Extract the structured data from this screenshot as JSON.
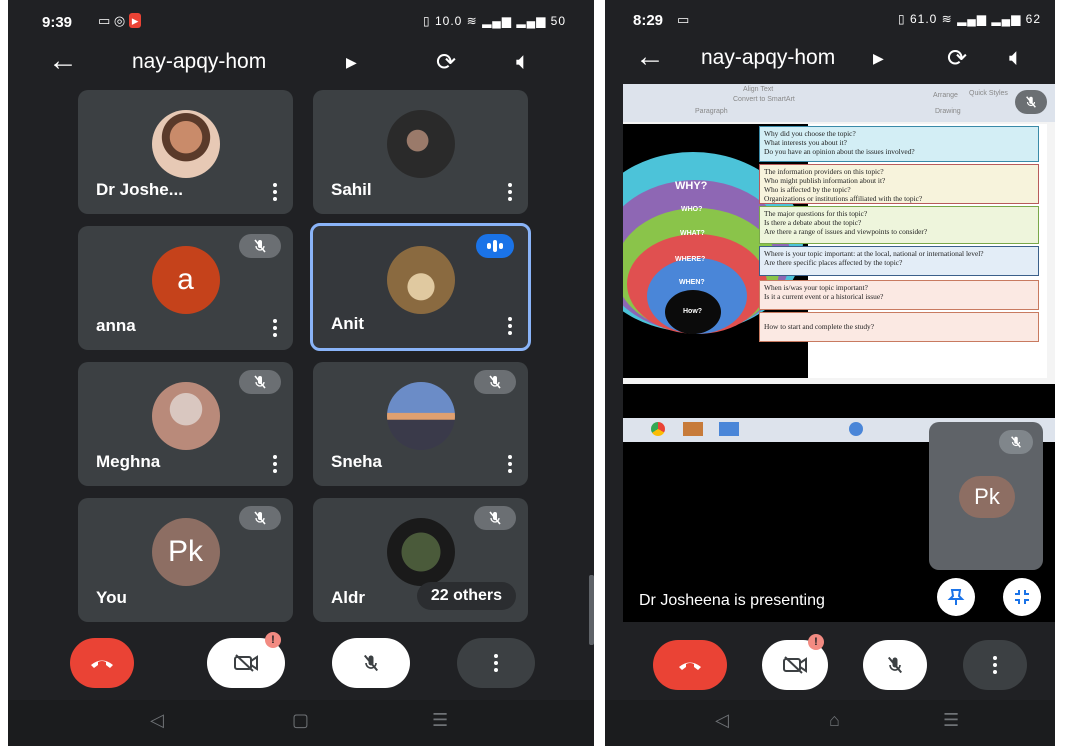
{
  "left": {
    "status": {
      "time": "9:39",
      "icons": "▯ 10.0 ≋ ▂▄▆ ▂▄▆ 50"
    },
    "meeting_code": "nay-apqy-hom",
    "tiles": [
      {
        "name": "Dr Joshe...",
        "avatar": "photo",
        "muted": false,
        "speaking": false
      },
      {
        "name": "Sahil",
        "avatar": "photo",
        "muted": false,
        "speaking": false
      },
      {
        "name": "anna",
        "avatar": "letter",
        "letter": "a",
        "muted": true,
        "speaking": false
      },
      {
        "name": "Anit",
        "avatar": "photo",
        "muted": false,
        "speaking": true
      },
      {
        "name": "Meghna",
        "avatar": "photo",
        "muted": true,
        "speaking": false
      },
      {
        "name": "Sneha",
        "avatar": "photo",
        "muted": true,
        "speaking": false
      },
      {
        "name": "You",
        "avatar": "letter",
        "letter": "Pk",
        "muted": true,
        "speaking": false
      },
      {
        "name": "Aldr",
        "avatar": "photo",
        "muted": true,
        "speaking": false
      }
    ],
    "others_label": "22 others",
    "camera_warning": "!"
  },
  "right": {
    "status": {
      "time": "8:29",
      "icons": "▯ 61.0 ≋ ▂▄▆ ▂▄▆ 62"
    },
    "meeting_code": "nay-apqy-hom",
    "ribbon": {
      "align_text": "Align Text",
      "smartart": "Convert to SmartArt",
      "paragraph": "Paragraph",
      "arrange": "Arrange",
      "quick_styles": "Quick Styles",
      "drawing": "Drawing"
    },
    "slide": {
      "circles": [
        "WHY?",
        "WHO?",
        "WHAT?",
        "WHERE?",
        "WHEN?",
        "How?"
      ],
      "questions": [
        [
          "Why did you choose the topic?",
          " What interests you about it?",
          "Do you have an opinion about the issues involved?"
        ],
        [
          "The information providers on this topic?",
          "Who might publish information about it?",
          "Who is affected by the topic?",
          "Organizations or institutions affiliated with the topic?"
        ],
        [
          "The major questions for this topic?",
          " Is there a debate about the topic?",
          "Are there a range of issues and viewpoints to consider?"
        ],
        [
          "Where is your topic important: at the local, national or international level?",
          "Are there specific places affected by the topic?"
        ],
        [
          "When is/was your topic important?",
          "Is it  a current event or a historical issue?"
        ],
        [
          "How to start and complete the study?"
        ]
      ]
    },
    "self_tile": {
      "letter": "Pk"
    },
    "presenting_label": "Dr Josheena is presenting",
    "camera_warning": "!"
  },
  "colors": {
    "background": "#202124",
    "tile": "#3c4043",
    "accent": "#8ab4f8",
    "end_call": "#ea4335"
  }
}
